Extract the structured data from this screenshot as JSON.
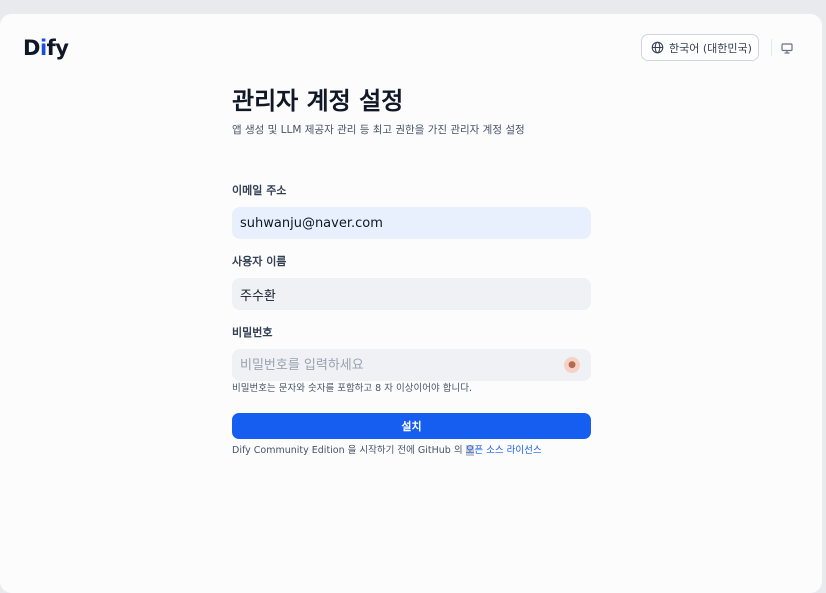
{
  "app": {
    "logo_prefix": "D",
    "logo_blue": "i",
    "logo_suffix": "fy"
  },
  "header": {
    "language_label": "한국어 (대한민국)",
    "language_icon": "globe-icon",
    "display_icon": "monitor-icon"
  },
  "form": {
    "title": "관리자 계정 설정",
    "subtitle": "앱 생성 및 LLM 제공자 관리 등 최고 권한을 가진 관리자 계정 설정",
    "email_label": "이메일 주소",
    "email_value": "suhwanju@naver.com",
    "username_label": "사용자 이름",
    "username_value": "주수환",
    "password_label": "비밀번호",
    "password_placeholder": "비밀번호를 입력하세요",
    "password_hint": "비밀번호는 문자와 숫자를 포함하고 8 자 이상이어야 합니다.",
    "install_button": "설치"
  },
  "footer": {
    "text_before": "Dify Community Edition 을 시작하기 전에 GitHub 의 ",
    "link_highlight": "오",
    "link_rest": "픈 소스 라이선스"
  },
  "colors": {
    "accent": "#155eef",
    "email_bg": "#e8f0fe",
    "input_bg": "#f0f1f4"
  }
}
